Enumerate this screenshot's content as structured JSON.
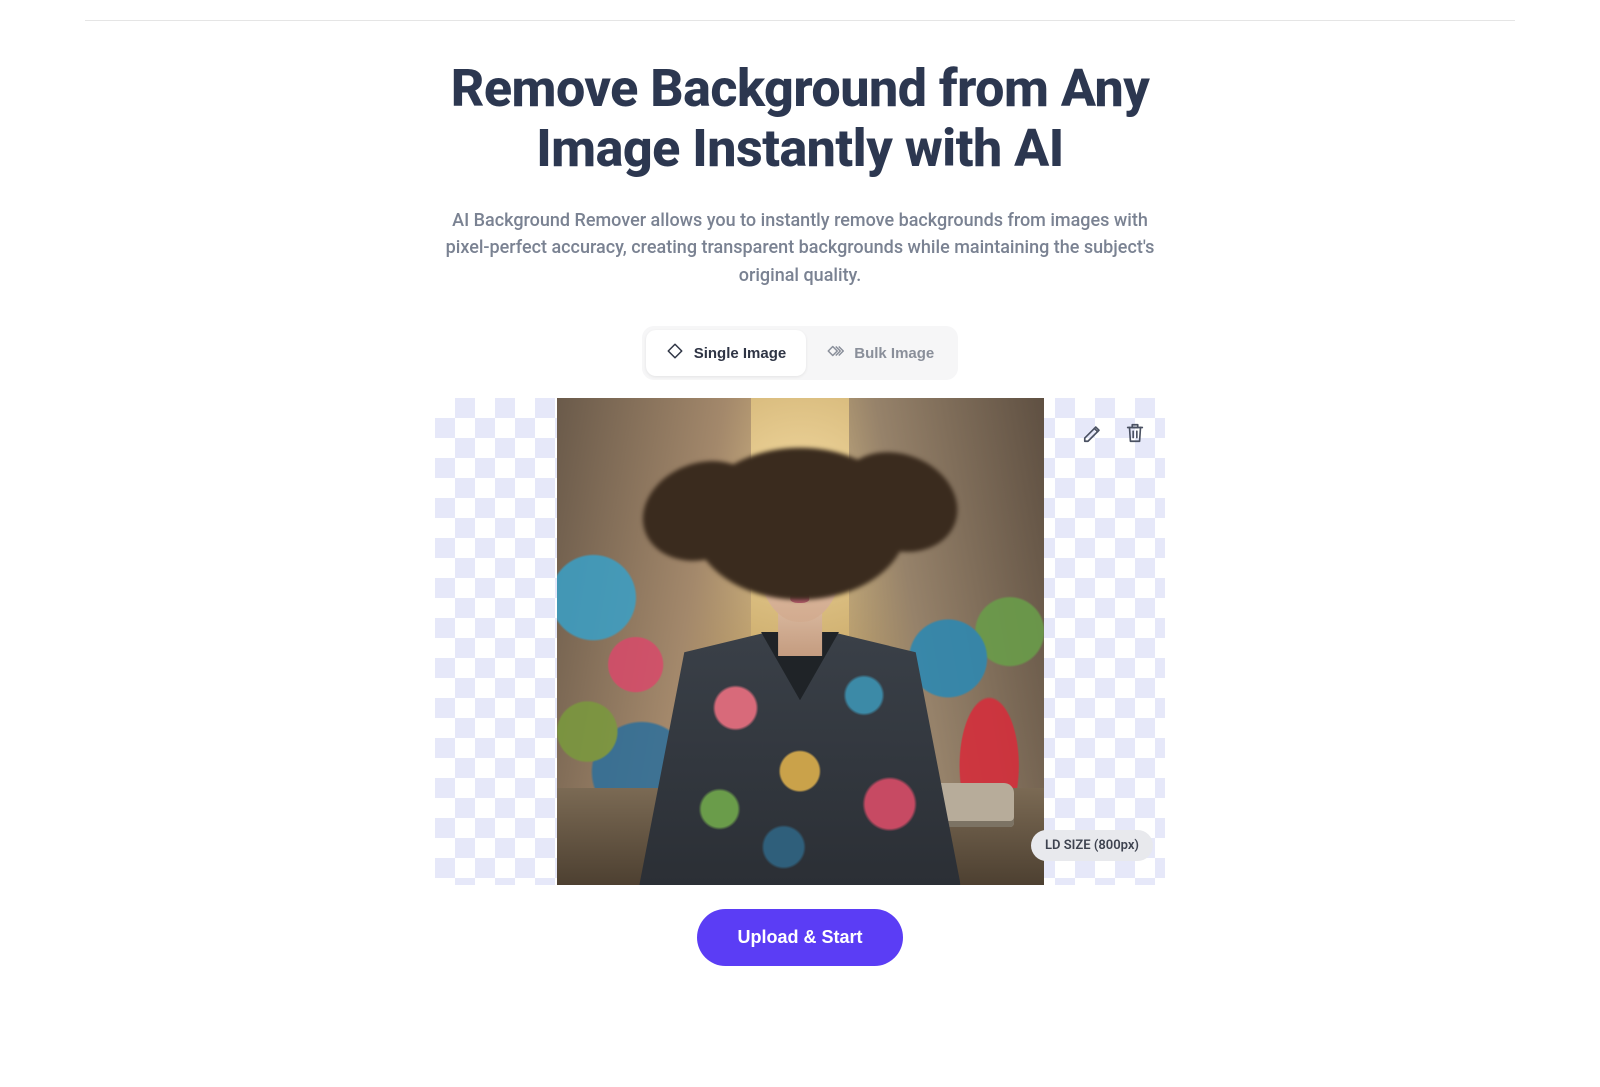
{
  "heading": "Remove Background from Any Image Instantly with AI",
  "subtitle": "AI Background Remover allows you to instantly remove backgrounds from images with pixel-perfect accuracy, creating transparent backgrounds while maintaining the subject's original quality.",
  "tabs": {
    "single": "Single Image",
    "bulk": "Bulk Image"
  },
  "badge": "LD SIZE (800px)",
  "upload_button": "Upload & Start"
}
